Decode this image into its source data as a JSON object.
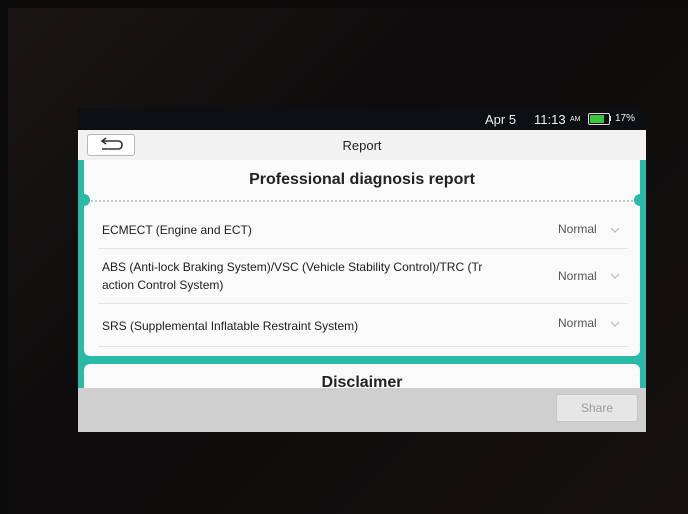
{
  "status_bar": {
    "date": "Apr 5",
    "time": "11:13",
    "ampm": "AM",
    "battery": "17%"
  },
  "app_bar": {
    "title": "Report",
    "back_icon": "back-arrow-icon"
  },
  "report": {
    "title": "Professional diagnosis report",
    "rows": [
      {
        "label": "ECMECT (Engine and ECT)",
        "status": "Normal"
      },
      {
        "label_line1": "ABS (Anti-lock Braking System)/VSC (Vehicle Stability Control)/TRC (Tr",
        "label_line2": "action Control System)",
        "status": "Normal"
      },
      {
        "label": "SRS (Supplemental Inflatable Restraint System)",
        "status": "Normal"
      }
    ]
  },
  "disclaimer": {
    "title": "Disclaimer"
  },
  "bottom_bar": {
    "share_label": "Share"
  },
  "colors": {
    "accent": "#2bb9a8",
    "battery": "#3cc43c"
  }
}
